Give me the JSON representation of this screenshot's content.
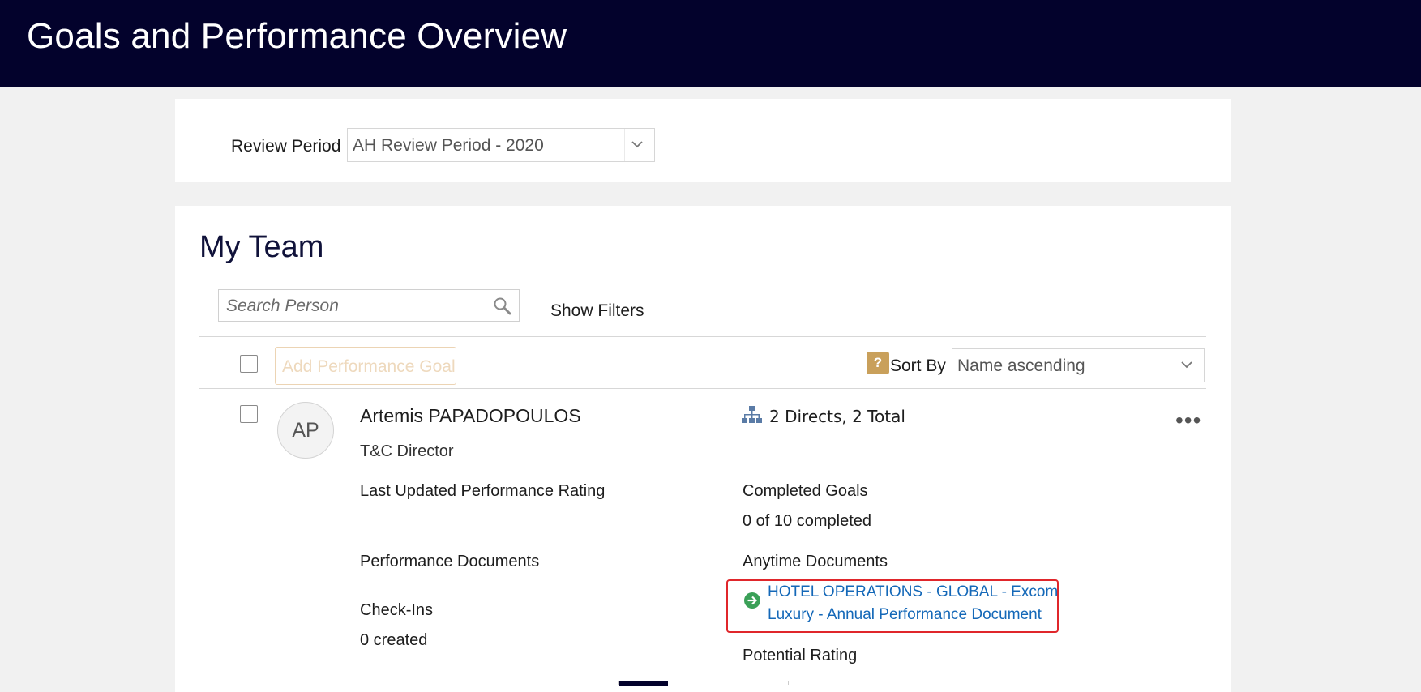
{
  "header": {
    "title": "Goals and Performance Overview"
  },
  "review": {
    "label": "Review Period",
    "selected": "AH Review Period - 2020"
  },
  "team": {
    "title": "My Team",
    "search_placeholder": "Search Person",
    "show_filters": "Show Filters",
    "add_goal": "Add Performance Goal",
    "help_symbol": "?",
    "sort_label": "Sort By",
    "sort_selected": "Name ascending"
  },
  "person": {
    "initials": "AP",
    "name": "Artemis PAPADOPOULOS",
    "title": "T&C Director",
    "directs": "2 Directs, 2 Total",
    "more": "•••",
    "last_rating_label": "Last Updated Performance Rating",
    "completed_goals_label": "Completed Goals",
    "completed_goals_value": "0 of 10 completed",
    "performance_docs_label": "Performance Documents",
    "anytime_docs_label": "Anytime Documents",
    "anytime_doc_line1": "HOTEL OPERATIONS - GLOBAL - Excom",
    "anytime_doc_line2": "Luxury - Annual Performance Document",
    "checkins_label": "Check-Ins",
    "checkins_value": "0 created",
    "potential_label": "Potential Rating"
  },
  "icons": {
    "search": "search-icon",
    "chevron": "chevron-down-icon",
    "org": "org-chart-icon",
    "go": "arrow-right-circle-icon",
    "more": "more-options-icon"
  },
  "colors": {
    "header_bg": "#03022c",
    "link": "#1468b8",
    "highlight": "#e0262b",
    "go_icon": "#3aa057",
    "help_bg": "#c9a05b"
  }
}
